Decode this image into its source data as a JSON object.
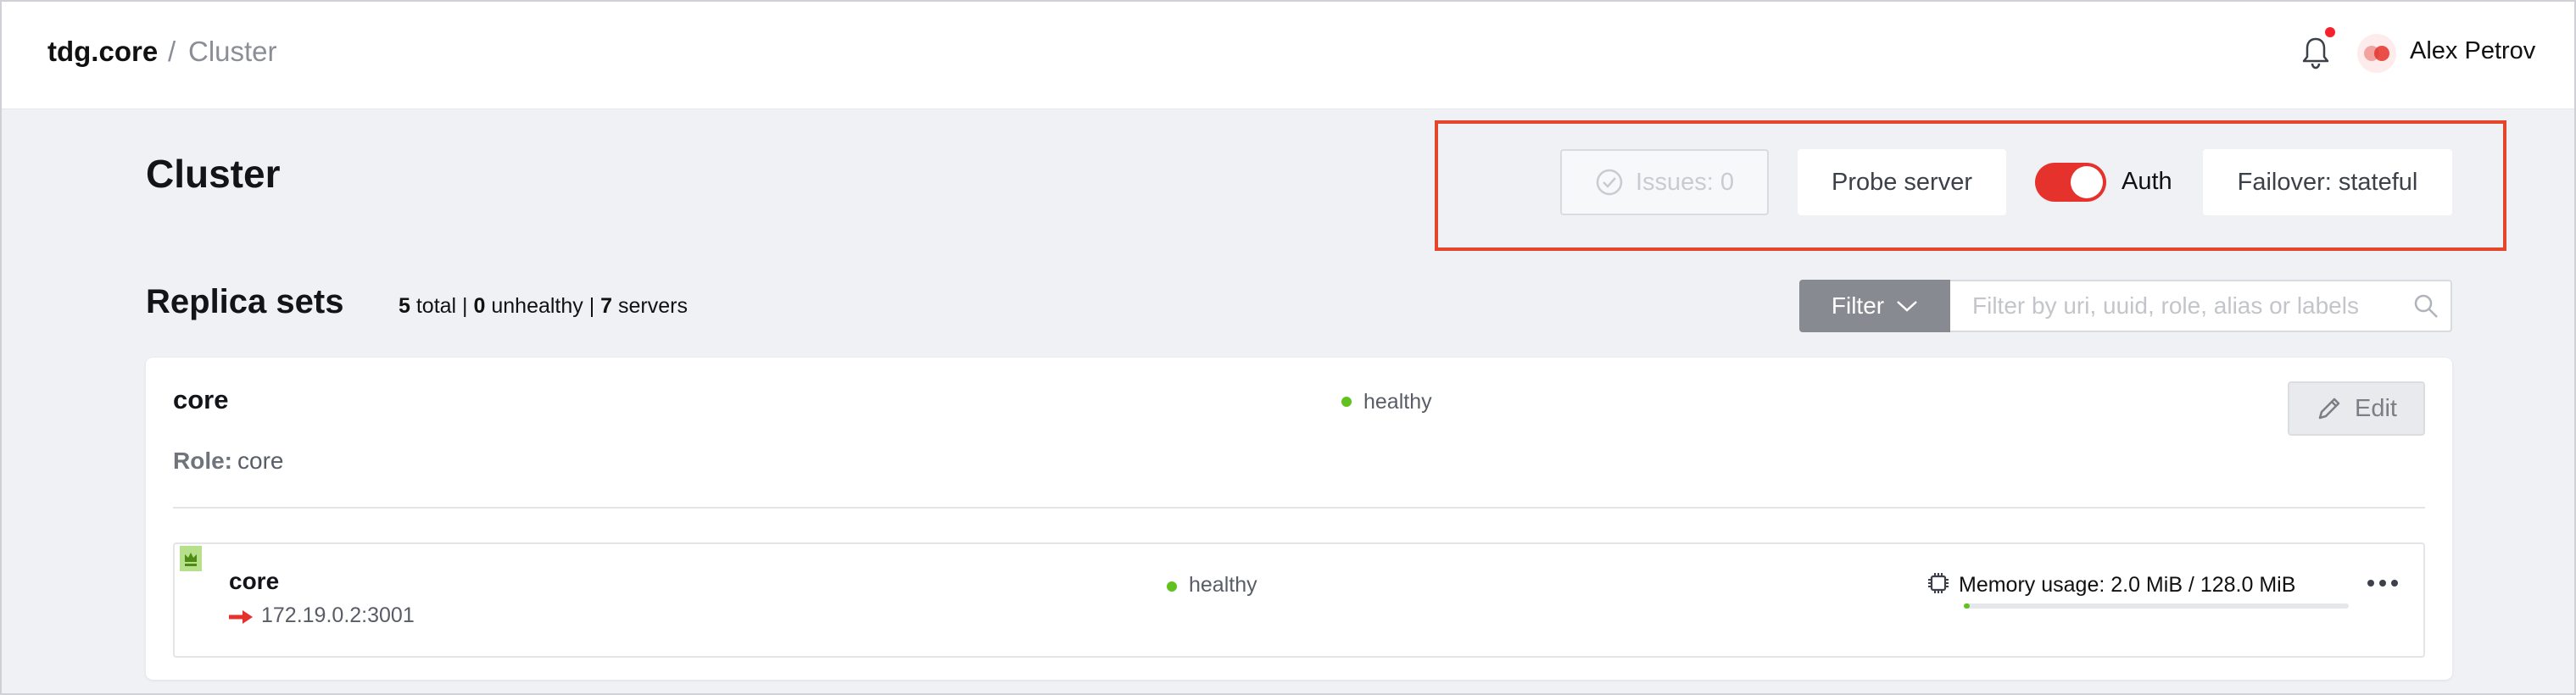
{
  "header": {
    "app_name": "tdg.core",
    "separator": "/",
    "page": "Cluster",
    "user_name": "Alex Petrov",
    "notification_dot_color": "#f5222d"
  },
  "page_title": "Cluster",
  "toolbar": {
    "issues_label": "Issues: 0",
    "probe_label": "Probe server",
    "auth_label": "Auth",
    "auth_enabled": true,
    "failover_label": "Failover: stateful",
    "accent_color": "#e5322d"
  },
  "replica_sets": {
    "title": "Replica sets",
    "total_count": "5",
    "total_label": " total",
    "unhealthy_count": "0",
    "unhealthy_label": " unhealthy",
    "servers_count": "7",
    "servers_label": " servers",
    "divider": " | ",
    "filter_label": "Filter",
    "filter_placeholder": "Filter by uri, uuid, role, alias or labels"
  },
  "replicaset": {
    "name": "core",
    "status": "healthy",
    "edit_label": "Edit",
    "role_label": "Role:",
    "role_value": " core",
    "server": {
      "name": "core",
      "uri": "172.19.0.2:3001",
      "status": "healthy",
      "memory_label": "Memory usage: 2.0 MiB / 128.0 MiB",
      "memory_fraction": 0.016
    }
  },
  "icons": [
    "bell-icon",
    "avatar-icon",
    "check-circle-icon",
    "chevron-down-icon",
    "search-icon",
    "pencil-icon",
    "crown-icon",
    "arrow-right-icon",
    "chip-icon",
    "more-icon"
  ]
}
